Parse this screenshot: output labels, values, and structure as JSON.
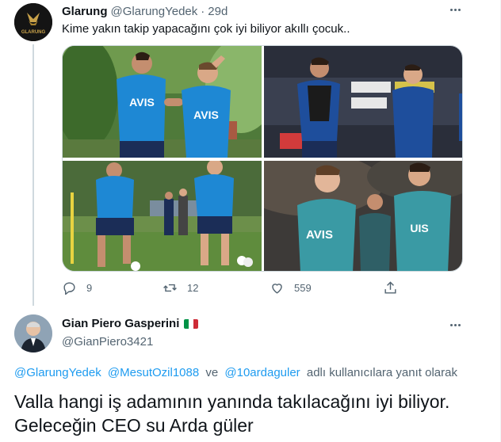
{
  "tweet": {
    "author_name": "Glarung",
    "author_handle": "@GlarungYedek",
    "separator": "·",
    "time": "29d",
    "text": "Kime yakın takip yapacağını çok iyi biliyor akıllı çocuk..",
    "avatar_text": "GLARUNG",
    "images": [
      {
        "jersey_text": "AVIS"
      },
      {
        "jersey_text": "AVIS"
      },
      {
        "jersey_text": "AVIS"
      }
    ],
    "actions": {
      "replies": "9",
      "retweets": "12",
      "likes": "559"
    }
  },
  "reply": {
    "author_name": "Gian Piero Gasperini",
    "author_handle": "@GianPiero3421",
    "reply_prefix": "",
    "mentions": [
      "@GlarungYedek",
      "@MesutOzil1088",
      "ve",
      "@10ardaguler"
    ],
    "reply_suffix": "adlı kullanıcılara yanıt olarak",
    "text": "Valla hangi iş adamının yanında takılacağını iyi biliyor. Geleceğin CEO su Arda güler"
  },
  "colors": {
    "accent": "#1d9bf0",
    "text": "#0f1419",
    "muted": "#536471",
    "jersey_blue": "#1e88d4",
    "jersey_navy": "#1b2d57",
    "jersey_teal": "#3a9aa4"
  }
}
